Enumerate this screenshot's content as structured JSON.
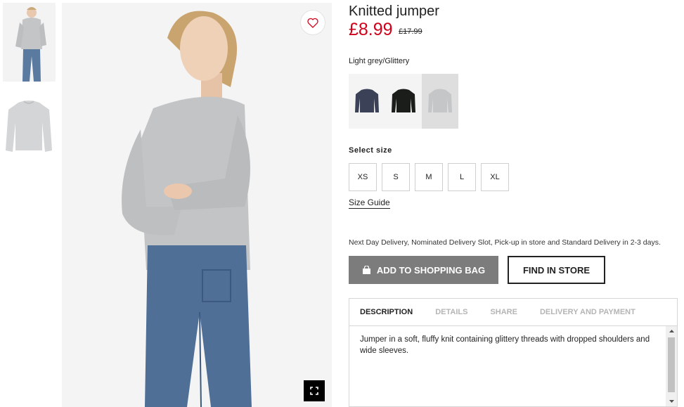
{
  "product": {
    "title": "Knitted jumper",
    "price": "£8.99",
    "old_price": "£17.99",
    "color_name": "Light grey/Glittery"
  },
  "swatches": [
    {
      "name": "dark-blue",
      "color": "#3b4257"
    },
    {
      "name": "black",
      "color": "#1b1d1b"
    },
    {
      "name": "light-grey",
      "color": "#c4c6c8"
    }
  ],
  "sizes": {
    "label": "Select size",
    "options": [
      "XS",
      "S",
      "M",
      "L",
      "XL"
    ],
    "guide_label": "Size Guide"
  },
  "delivery_note": "Next Day Delivery, Nominated Delivery Slot, Pick-up in store and Standard Delivery in 2-3 days.",
  "buttons": {
    "add_to_bag": "ADD TO SHOPPING BAG",
    "find_in_store": "FIND IN STORE"
  },
  "tabs": [
    "DESCRIPTION",
    "DETAILS",
    "SHARE",
    "DELIVERY AND PAYMENT"
  ],
  "description": "Jumper in a soft, fluffy knit containing glittery threads with dropped shoulders and wide sleeves.",
  "colors": {
    "price_red": "#d0021b",
    "button_grey": "#7c7c7c"
  },
  "icons": {
    "favorite": "heart-icon",
    "expand": "fullscreen-icon",
    "bag": "shopping-bag-icon"
  }
}
